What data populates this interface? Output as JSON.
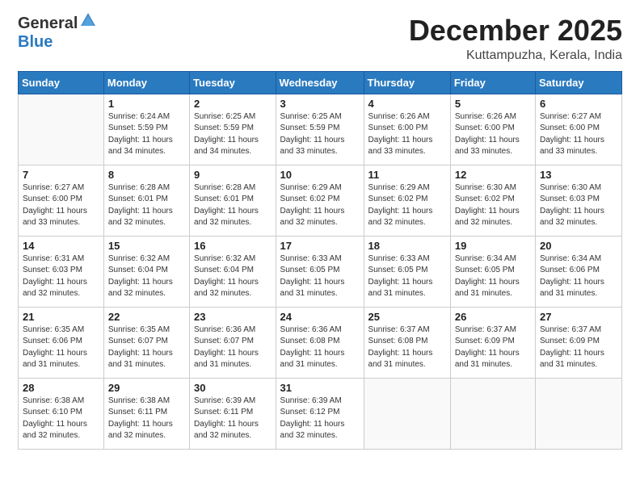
{
  "header": {
    "logo_general": "General",
    "logo_blue": "Blue",
    "month_title": "December 2025",
    "location": "Kuttampuzha, Kerala, India"
  },
  "weekdays": [
    "Sunday",
    "Monday",
    "Tuesday",
    "Wednesday",
    "Thursday",
    "Friday",
    "Saturday"
  ],
  "weeks": [
    [
      {
        "day": "",
        "info": ""
      },
      {
        "day": "1",
        "info": "Sunrise: 6:24 AM\nSunset: 5:59 PM\nDaylight: 11 hours\nand 34 minutes."
      },
      {
        "day": "2",
        "info": "Sunrise: 6:25 AM\nSunset: 5:59 PM\nDaylight: 11 hours\nand 34 minutes."
      },
      {
        "day": "3",
        "info": "Sunrise: 6:25 AM\nSunset: 5:59 PM\nDaylight: 11 hours\nand 33 minutes."
      },
      {
        "day": "4",
        "info": "Sunrise: 6:26 AM\nSunset: 6:00 PM\nDaylight: 11 hours\nand 33 minutes."
      },
      {
        "day": "5",
        "info": "Sunrise: 6:26 AM\nSunset: 6:00 PM\nDaylight: 11 hours\nand 33 minutes."
      },
      {
        "day": "6",
        "info": "Sunrise: 6:27 AM\nSunset: 6:00 PM\nDaylight: 11 hours\nand 33 minutes."
      }
    ],
    [
      {
        "day": "7",
        "info": "Sunrise: 6:27 AM\nSunset: 6:00 PM\nDaylight: 11 hours\nand 33 minutes."
      },
      {
        "day": "8",
        "info": "Sunrise: 6:28 AM\nSunset: 6:01 PM\nDaylight: 11 hours\nand 32 minutes."
      },
      {
        "day": "9",
        "info": "Sunrise: 6:28 AM\nSunset: 6:01 PM\nDaylight: 11 hours\nand 32 minutes."
      },
      {
        "day": "10",
        "info": "Sunrise: 6:29 AM\nSunset: 6:02 PM\nDaylight: 11 hours\nand 32 minutes."
      },
      {
        "day": "11",
        "info": "Sunrise: 6:29 AM\nSunset: 6:02 PM\nDaylight: 11 hours\nand 32 minutes."
      },
      {
        "day": "12",
        "info": "Sunrise: 6:30 AM\nSunset: 6:02 PM\nDaylight: 11 hours\nand 32 minutes."
      },
      {
        "day": "13",
        "info": "Sunrise: 6:30 AM\nSunset: 6:03 PM\nDaylight: 11 hours\nand 32 minutes."
      }
    ],
    [
      {
        "day": "14",
        "info": "Sunrise: 6:31 AM\nSunset: 6:03 PM\nDaylight: 11 hours\nand 32 minutes."
      },
      {
        "day": "15",
        "info": "Sunrise: 6:32 AM\nSunset: 6:04 PM\nDaylight: 11 hours\nand 32 minutes."
      },
      {
        "day": "16",
        "info": "Sunrise: 6:32 AM\nSunset: 6:04 PM\nDaylight: 11 hours\nand 32 minutes."
      },
      {
        "day": "17",
        "info": "Sunrise: 6:33 AM\nSunset: 6:05 PM\nDaylight: 11 hours\nand 31 minutes."
      },
      {
        "day": "18",
        "info": "Sunrise: 6:33 AM\nSunset: 6:05 PM\nDaylight: 11 hours\nand 31 minutes."
      },
      {
        "day": "19",
        "info": "Sunrise: 6:34 AM\nSunset: 6:05 PM\nDaylight: 11 hours\nand 31 minutes."
      },
      {
        "day": "20",
        "info": "Sunrise: 6:34 AM\nSunset: 6:06 PM\nDaylight: 11 hours\nand 31 minutes."
      }
    ],
    [
      {
        "day": "21",
        "info": "Sunrise: 6:35 AM\nSunset: 6:06 PM\nDaylight: 11 hours\nand 31 minutes."
      },
      {
        "day": "22",
        "info": "Sunrise: 6:35 AM\nSunset: 6:07 PM\nDaylight: 11 hours\nand 31 minutes."
      },
      {
        "day": "23",
        "info": "Sunrise: 6:36 AM\nSunset: 6:07 PM\nDaylight: 11 hours\nand 31 minutes."
      },
      {
        "day": "24",
        "info": "Sunrise: 6:36 AM\nSunset: 6:08 PM\nDaylight: 11 hours\nand 31 minutes."
      },
      {
        "day": "25",
        "info": "Sunrise: 6:37 AM\nSunset: 6:08 PM\nDaylight: 11 hours\nand 31 minutes."
      },
      {
        "day": "26",
        "info": "Sunrise: 6:37 AM\nSunset: 6:09 PM\nDaylight: 11 hours\nand 31 minutes."
      },
      {
        "day": "27",
        "info": "Sunrise: 6:37 AM\nSunset: 6:09 PM\nDaylight: 11 hours\nand 31 minutes."
      }
    ],
    [
      {
        "day": "28",
        "info": "Sunrise: 6:38 AM\nSunset: 6:10 PM\nDaylight: 11 hours\nand 32 minutes."
      },
      {
        "day": "29",
        "info": "Sunrise: 6:38 AM\nSunset: 6:11 PM\nDaylight: 11 hours\nand 32 minutes."
      },
      {
        "day": "30",
        "info": "Sunrise: 6:39 AM\nSunset: 6:11 PM\nDaylight: 11 hours\nand 32 minutes."
      },
      {
        "day": "31",
        "info": "Sunrise: 6:39 AM\nSunset: 6:12 PM\nDaylight: 11 hours\nand 32 minutes."
      },
      {
        "day": "",
        "info": ""
      },
      {
        "day": "",
        "info": ""
      },
      {
        "day": "",
        "info": ""
      }
    ]
  ]
}
